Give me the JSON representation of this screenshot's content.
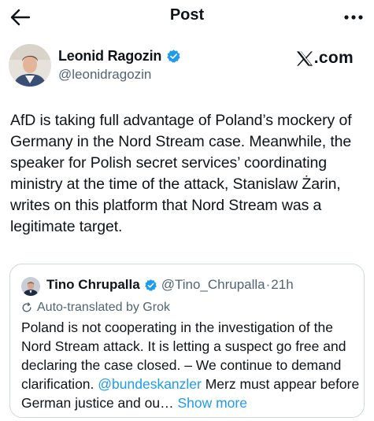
{
  "header": {
    "title": "Post",
    "back_icon": "arrow-left-icon",
    "more_icon": "more-horizontal-icon"
  },
  "author": {
    "name": "Leonid Ragozin",
    "handle": "@leonidragozin",
    "verified": true,
    "badge_color": "#1d9bf0"
  },
  "brand": {
    "logo_text": ".com",
    "icon": "x-logo-icon"
  },
  "post": {
    "text": "AfD is taking full advantage of Poland’s mockery of Germany in the Nord Stream case. Meanwhile, the speaker for Polish secret services’ coordinating ministry at the time of the attack, Stanislaw Żarin, writes on this platform that Nord Stream was a legitimate target."
  },
  "quote": {
    "name": "Tino Chrupalla",
    "handle": "@Tino_Chrupalla",
    "separator": "·",
    "time": "21h",
    "verified": true,
    "translated_label": "Auto-translated by Grok",
    "text_before_mention": "Poland is not cooperating in the investigation of the Nord Stream attack. It is letting a suspect go free and declaring the case closed. – We continue to demand clarification. ",
    "mention": "@bundeskanzler",
    "text_after_mention": " Merz must appear before German justice and ou…",
    "show_more": " Show more"
  },
  "colors": {
    "link": "#1d9bf0",
    "secondary_text": "#536471",
    "border": "#cfd9de"
  }
}
